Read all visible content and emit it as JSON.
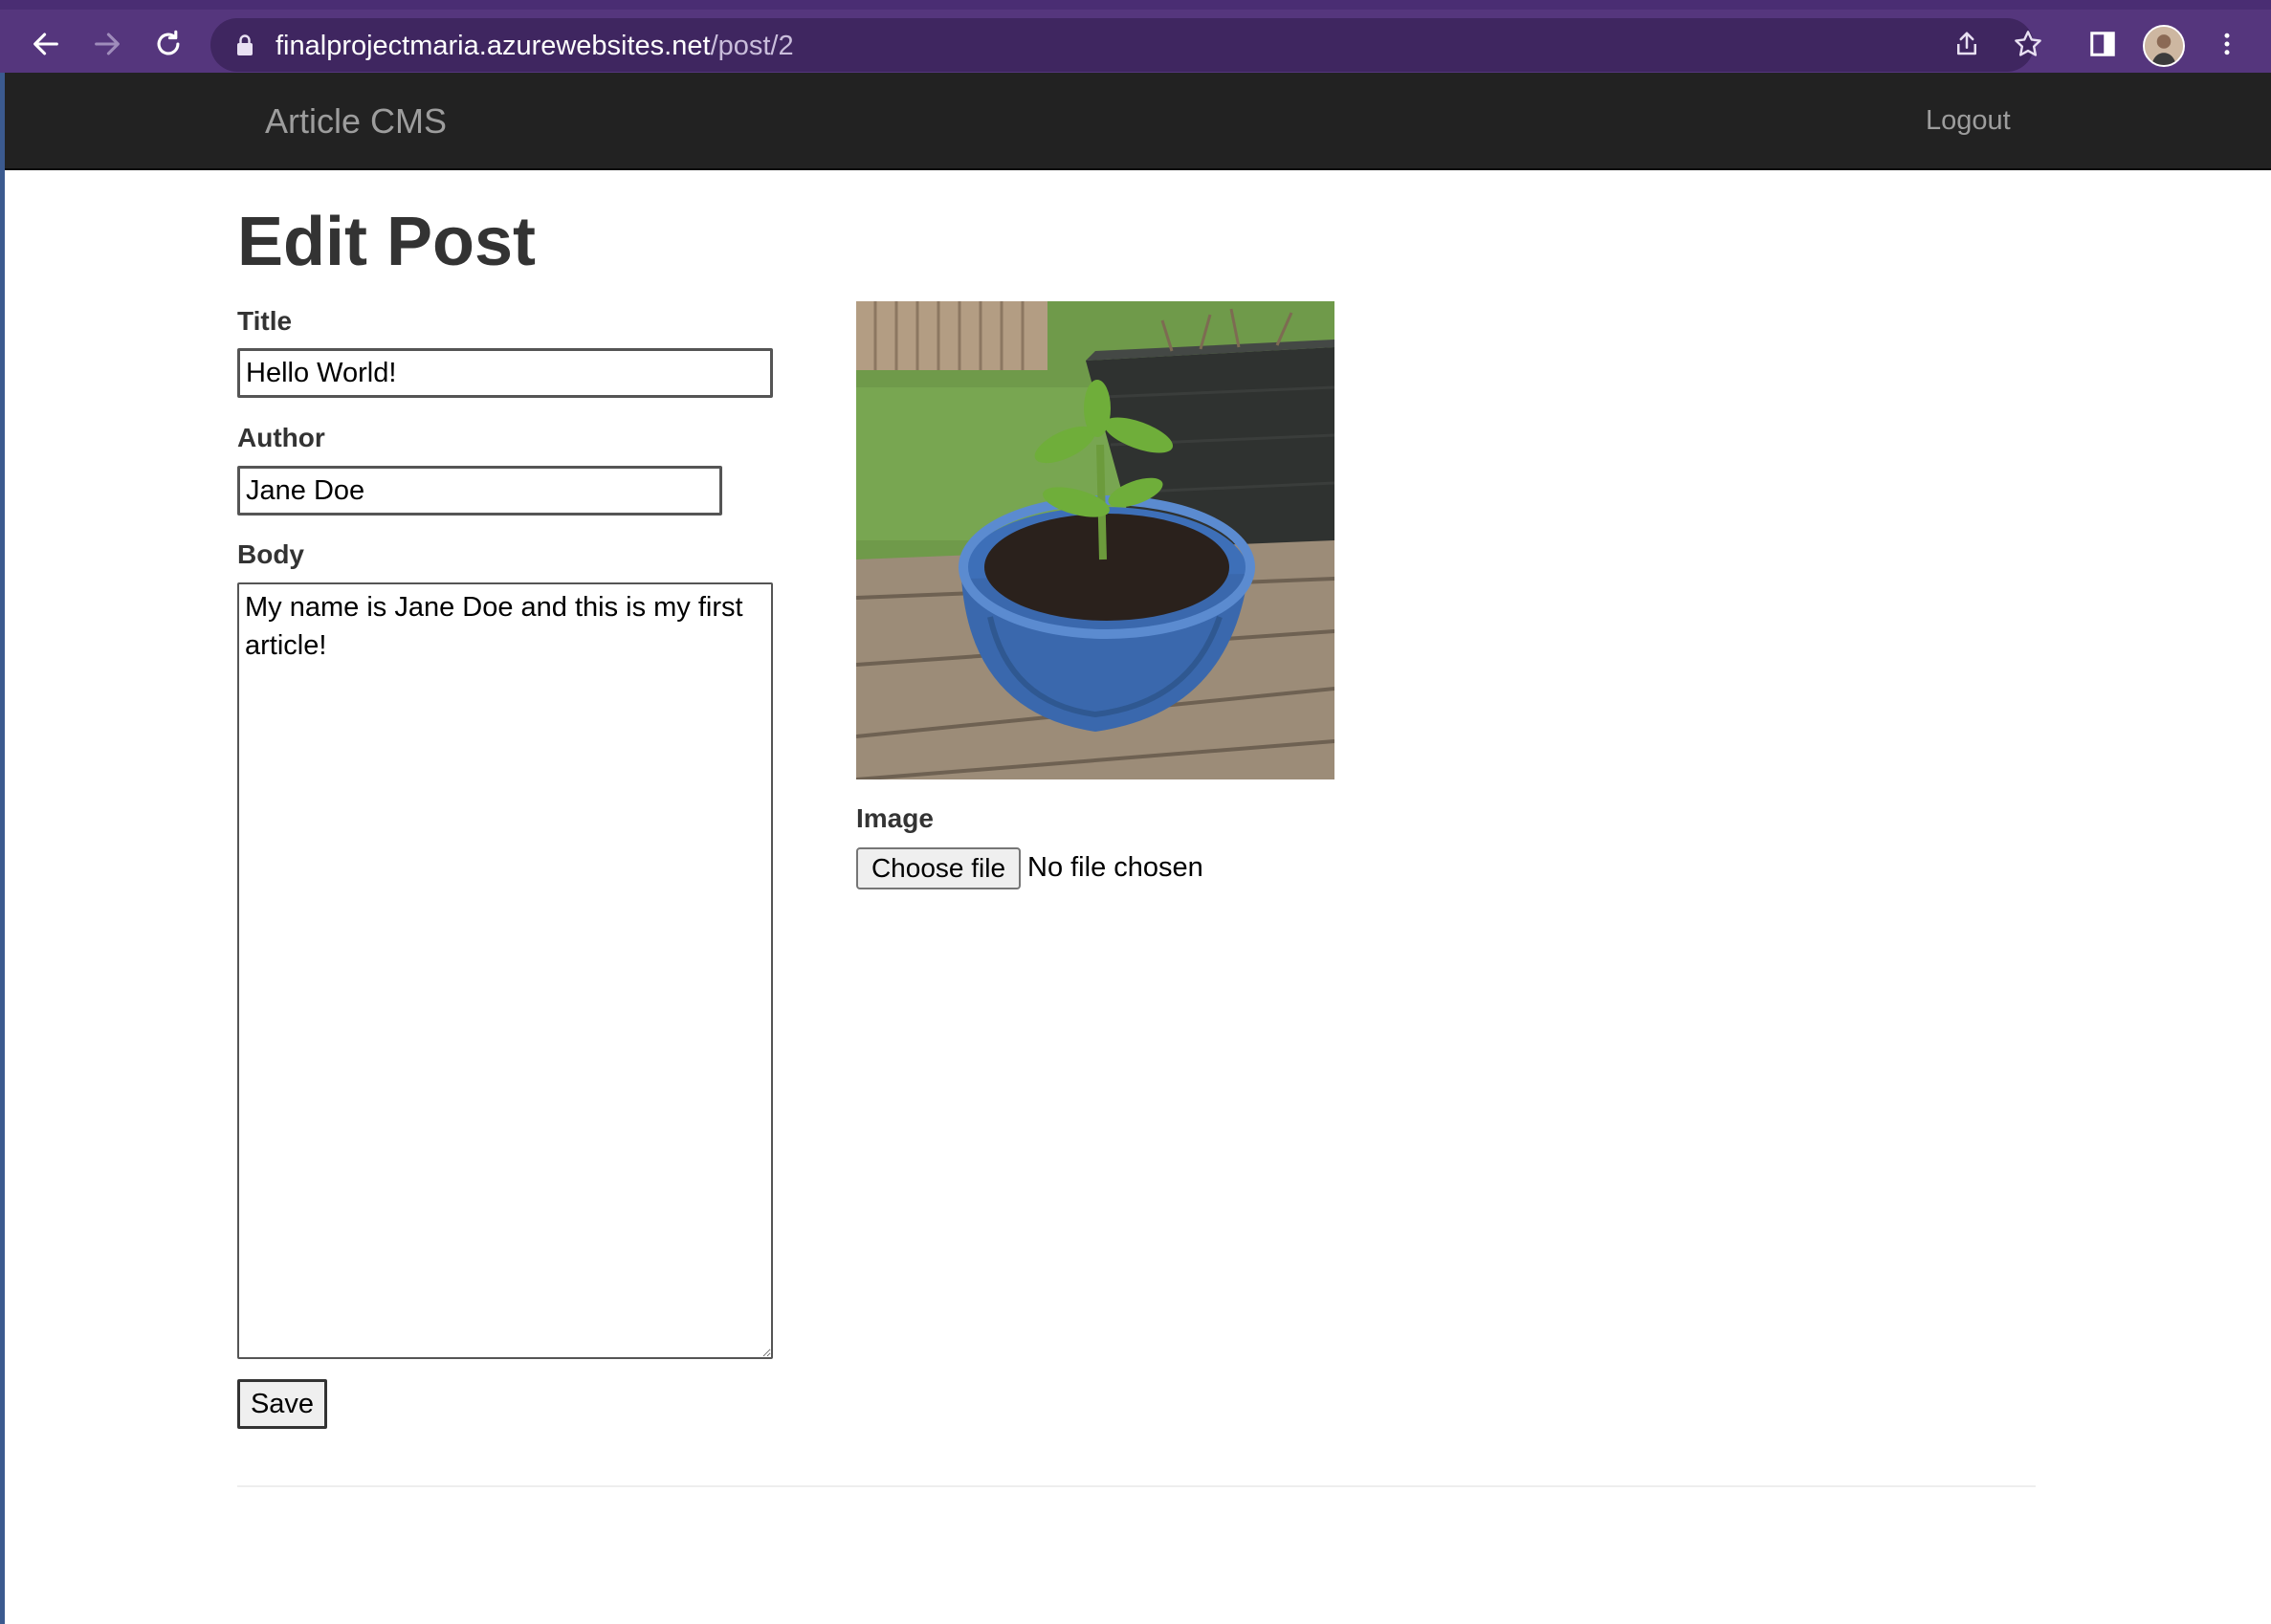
{
  "browser": {
    "url_host": "finalprojectmaria.azurewebsites.net",
    "url_path": "/post/2",
    "icons": [
      "back-arrow-icon",
      "forward-arrow-icon",
      "reload-icon",
      "lock-icon",
      "share-icon",
      "star-icon",
      "side-panel-icon",
      "profile-avatar",
      "menu-dots-icon"
    ]
  },
  "navbar": {
    "brand": "Article CMS",
    "logout": "Logout"
  },
  "form": {
    "heading": "Edit Post",
    "title_label": "Title",
    "title_value": "Hello World!",
    "author_label": "Author",
    "author_value": "Jane Doe",
    "body_label": "Body",
    "body_value": "My name is Jane Doe and this is my first article!",
    "save_label": "Save",
    "image_label": "Image",
    "choose_file_label": "Choose file",
    "no_file_text": "No file chosen"
  },
  "colors": {
    "browser_frame": "#55367d",
    "navbar_bg": "#222222",
    "navbar_text": "#9d9d9d",
    "heading_text": "#333333"
  }
}
